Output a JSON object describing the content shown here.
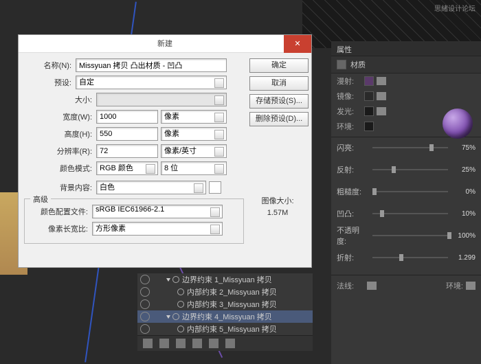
{
  "watermark": "思緒设计论坛",
  "dialog": {
    "title": "新建",
    "name_label": "名称(N):",
    "name_value": "Missyuan 拷贝 凸出材质 - 凹凸",
    "preset_label": "预设:",
    "preset_value": "自定",
    "size_label": "大小:",
    "width_label": "宽度(W):",
    "width_value": "1000",
    "width_unit": "像素",
    "height_label": "高度(H):",
    "height_value": "550",
    "height_unit": "像素",
    "res_label": "分辨率(R):",
    "res_value": "72",
    "res_unit": "像素/英寸",
    "mode_label": "颜色模式:",
    "mode_value": "RGB 颜色",
    "bit_value": "8 位",
    "bg_label": "背景内容:",
    "bg_value": "白色",
    "advanced": "高级",
    "profile_label": "颜色配置文件:",
    "profile_value": "sRGB IEC61966-2.1",
    "aspect_label": "像素长宽比:",
    "aspect_value": "方形像素",
    "ok": "确定",
    "cancel": "取消",
    "save_preset": "存储预设(S)...",
    "delete_preset": "删除预设(D)...",
    "size_title": "图像大小:",
    "size_val": "1.57M"
  },
  "props": {
    "title": "属性",
    "subtitle": "材质",
    "diffuse": "漫射:",
    "specular": "镜像:",
    "glow": "发光:",
    "ambient": "环境:",
    "shine": "闪亮:",
    "shine_v": "75%",
    "reflect": "反射:",
    "reflect_v": "25%",
    "rough": "粗糙度:",
    "rough_v": "0%",
    "bump": "凹凸:",
    "bump_v": "10%",
    "opacity": "不透明度:",
    "opacity_v": "100%",
    "refract": "折射:",
    "refract_v": "1.299",
    "normal": "法线:",
    "env": "环境:"
  },
  "hier": {
    "r1": "边界约束 1_Missyuan 拷贝",
    "r2": "内部约束 2_Missyuan 拷贝",
    "r3": "内部约束 3_Missyuan 拷贝",
    "r4": "边界约束 4_Missyuan 拷贝",
    "r5": "内部约束 5_Missyuan 拷贝"
  }
}
